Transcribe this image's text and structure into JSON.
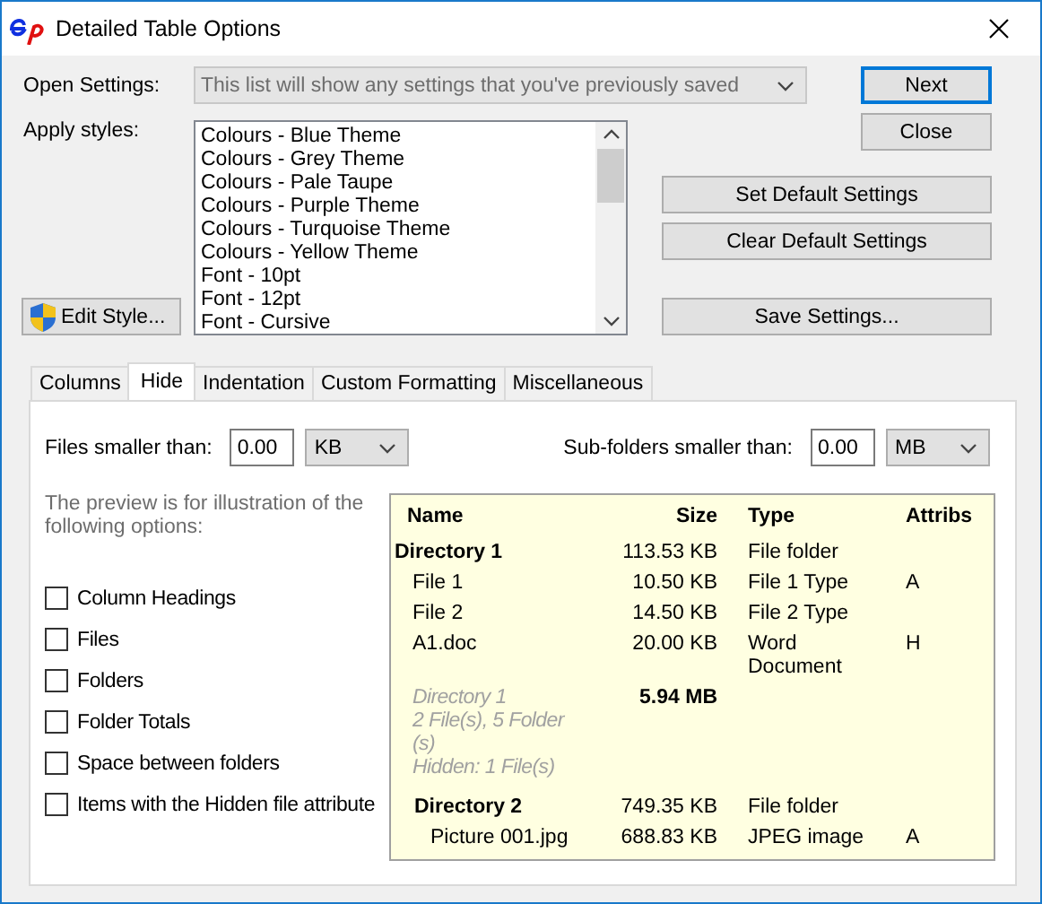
{
  "window": {
    "title": "Detailed Table Options"
  },
  "open_settings": {
    "label": "Open Settings:",
    "value": "This list will show any settings that you've previously saved",
    "disabled": true
  },
  "apply_styles": {
    "label": "Apply styles:",
    "items": [
      "Colours - Blue Theme",
      "Colours - Grey Theme",
      "Colours - Pale Taupe",
      "Colours - Purple Theme",
      "Colours - Turquoise Theme",
      "Colours - Yellow Theme",
      "Font - 10pt",
      "Font - 12pt",
      "Font - Cursive"
    ]
  },
  "buttons": [
    {
      "label": "Next",
      "default": true
    },
    {
      "label": "Close",
      "default": false
    },
    {
      "label": "Set Default Settings",
      "default": false
    },
    {
      "label": "Clear Default Settings",
      "default": false
    },
    {
      "label": "Save Settings...",
      "default": false
    }
  ],
  "edit_style_button": {
    "label": "Edit Style..."
  },
  "tabs": [
    {
      "label": "Columns",
      "selected": false
    },
    {
      "label": "Hide",
      "selected": true
    },
    {
      "label": "Indentation",
      "selected": false
    },
    {
      "label": "Custom Formatting",
      "selected": false
    },
    {
      "label": "Miscellaneous",
      "selected": false
    }
  ],
  "hide_tab": {
    "files_smaller_than": {
      "label": "Files smaller than:",
      "value": "0.00",
      "unit": "KB"
    },
    "subfolders_smaller_than": {
      "label": "Sub-folders smaller than:",
      "value": "0.00",
      "unit": "MB"
    },
    "preview_note": "The preview is for illustration of the following options:",
    "options": [
      {
        "label": "Column Headings",
        "checked": false
      },
      {
        "label": "Files",
        "checked": false
      },
      {
        "label": "Folders",
        "checked": false
      },
      {
        "label": "Folder Totals",
        "checked": false
      },
      {
        "label": "Space between folders",
        "checked": false
      },
      {
        "label": "Items with the Hidden file attribute",
        "checked": false
      }
    ],
    "preview": {
      "columns": [
        "Name",
        "Size",
        "Type",
        "Attribs"
      ],
      "rows": [
        {
          "kind": "folder",
          "name": "Directory 1",
          "size": "113.53 KB",
          "type": "File folder",
          "children": [
            {
              "kind": "file",
              "name": "File 1",
              "size": "10.50 KB",
              "type": "File 1 Type",
              "attribs": "A"
            },
            {
              "kind": "file",
              "name": "File 2",
              "size": "14.50 KB",
              "type": "File 2 Type"
            },
            {
              "kind": "file",
              "name": "A1.doc",
              "size": "20.00 KB",
              "type": "Word Document",
              "attribs": "H"
            },
            {
              "kind": "summary",
              "name": "Directory 1\n2 File(s), 5 Folder\n(s)\nHidden: 1 File(s)",
              "size": "5.94 MB"
            },
            {
              "kind": "folder",
              "name": "Directory 2",
              "size": "749.35 KB",
              "type": "File folder",
              "children": [
                {
                  "kind": "file",
                  "name": "Picture 001.jpg",
                  "size": "688.83 KB",
                  "type": "JPEG image",
                  "attribs": "A"
                }
              ]
            }
          ]
        }
      ]
    }
  }
}
